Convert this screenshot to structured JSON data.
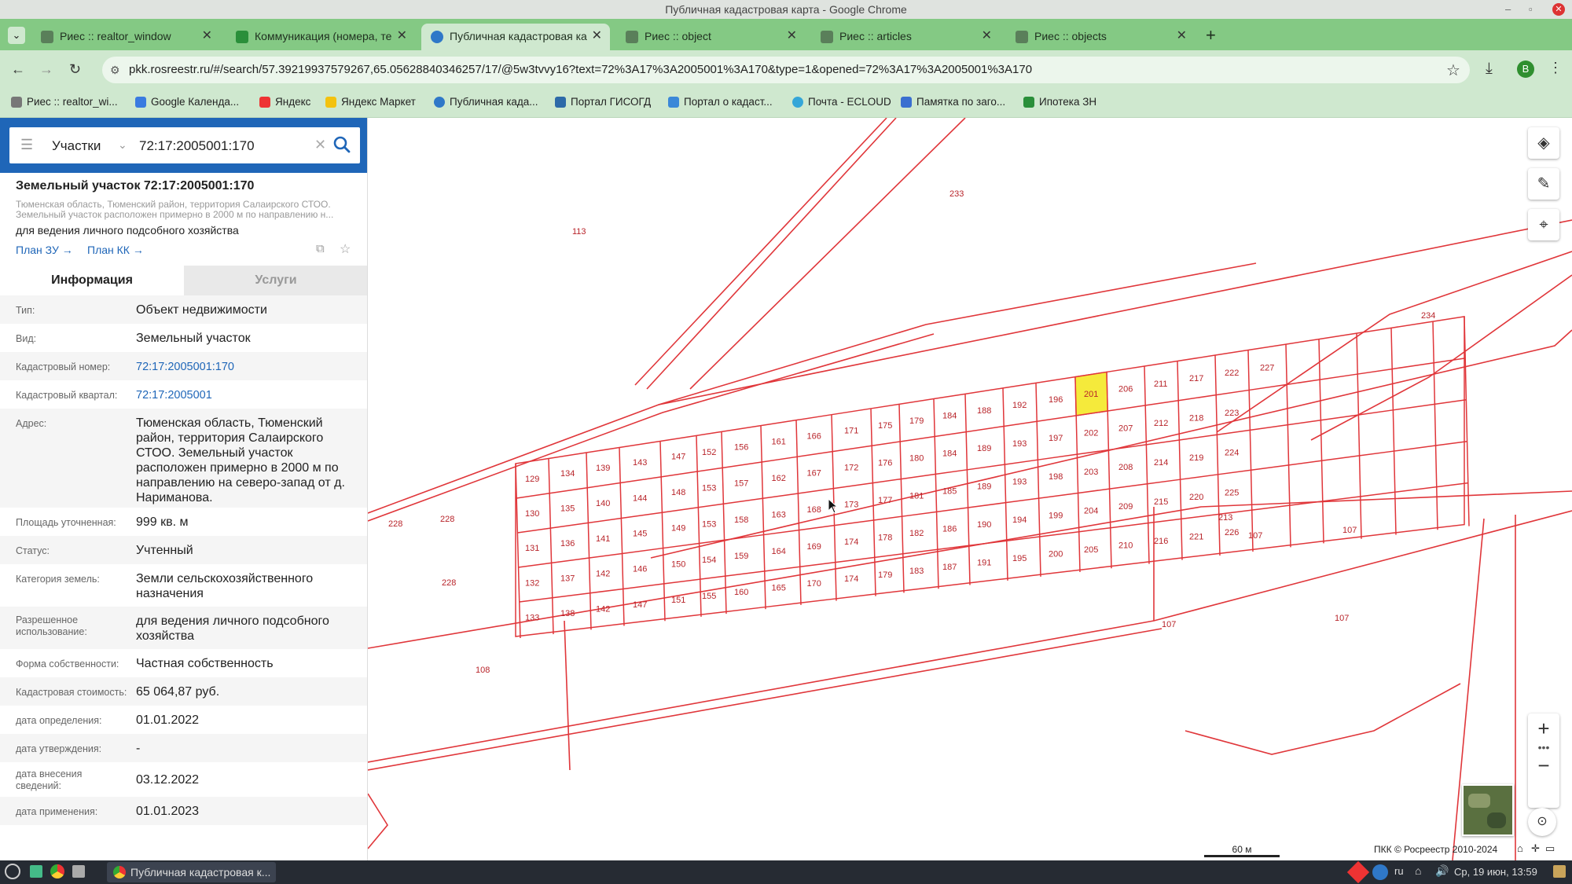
{
  "window": {
    "title": "Публичная кадастровая карта - Google Chrome"
  },
  "tabs": [
    {
      "label": "Риес :: realtor_window"
    },
    {
      "label": "Коммуникация (номера, те"
    },
    {
      "label": "Публичная кадастровая ка",
      "active": true
    },
    {
      "label": "Риес :: object"
    },
    {
      "label": "Риес :: articles"
    },
    {
      "label": "Риес :: objects"
    }
  ],
  "address_bar": {
    "url": "pkk.rosreestr.ru/#/search/57.39219937579267,65.05628840346257/17/@5w3tvvy16?text=72%3A17%3A2005001%3A170&type=1&opened=72%3A17%3A2005001%3A170",
    "profile_initial": "B"
  },
  "bookmarks": [
    {
      "label": "Риес :: realtor_wi..."
    },
    {
      "label": "Google Календа..."
    },
    {
      "label": "Яндекс"
    },
    {
      "label": "Яндекс Маркет"
    },
    {
      "label": "Публичная када..."
    },
    {
      "label": "Портал ГИСОГД"
    },
    {
      "label": "Портал о кадаст..."
    },
    {
      "label": "Почта - ECLOUD"
    },
    {
      "label": "Памятка по заго..."
    },
    {
      "label": "Ипотека ЗН"
    }
  ],
  "search": {
    "type": "Участки",
    "value": "72:17:2005001:170"
  },
  "parcel": {
    "title": "Земельный участок 72:17:2005001:170",
    "address_short_1": "Тюменская область, Тюменский район, территория Салаирского СТОО.",
    "address_short_2": "Земельный участок расположен примерно в 2000 м по направлению н...",
    "usage": "для ведения личного подсобного хозяйства",
    "plan_zu": "План ЗУ →",
    "plan_kk": "План КК →"
  },
  "info_tabs": {
    "info": "Информация",
    "services": "Услуги"
  },
  "info_rows": [
    {
      "label": "Тип:",
      "value": "Объект недвижимости"
    },
    {
      "label": "Вид:",
      "value": "Земельный участок"
    },
    {
      "label": "Кадастровый номер:",
      "value": "72:17:2005001:170"
    },
    {
      "label": "Кадастровый квартал:",
      "value": "72:17:2005001"
    },
    {
      "label": "Адрес:",
      "value": "Тюменская область, Тюменский район, территория Салаирского СТОО. Земельный участок расположен примерно в 2000 м по направлению на северо-запад от д. Нариманова."
    },
    {
      "label": "Площадь уточненная:",
      "value": "999 кв. м"
    },
    {
      "label": "Статус:",
      "value": "Учтенный"
    },
    {
      "label": "Категория земель:",
      "value": "Земли сельскохозяйственного назначения"
    },
    {
      "label": "Разрешенное использование:",
      "value": "для ведения личного подсобного хозяйства"
    },
    {
      "label": "Форма собственности:",
      "value": "Частная собственность"
    },
    {
      "label": "Кадастровая стоимость:",
      "value": "65 064,87 руб."
    },
    {
      "label": "дата определения:",
      "value": "01.01.2022"
    },
    {
      "label": "дата утверждения:",
      "value": "-"
    },
    {
      "label": "дата внесения сведений:",
      "value": "03.12.2022"
    },
    {
      "label": "дата применения:",
      "value": "01.01.2023"
    }
  ],
  "map": {
    "scale": "60 м",
    "copyright": "ПКК © Росреестр 2010-2024",
    "selected_parcel": "170",
    "outer_labels": [
      "233",
      "113",
      "228",
      "228",
      "228",
      "107",
      "107",
      "107",
      "107",
      "108",
      "234",
      "213"
    ],
    "parcel_labels": [
      "129",
      "130",
      "131",
      "132",
      "133",
      "134",
      "135",
      "136",
      "137",
      "138",
      "139",
      "140",
      "141",
      "142",
      "142",
      "143",
      "144",
      "145",
      "146",
      "147",
      "147",
      "148",
      "149",
      "150",
      "151",
      "152",
      "153",
      "153",
      "154",
      "155",
      "156",
      "157",
      "158",
      "159",
      "160",
      "161",
      "162",
      "163",
      "164",
      "165",
      "166",
      "167",
      "168",
      "169",
      "170",
      "171",
      "172",
      "173",
      "174",
      "174",
      "175",
      "176",
      "177",
      "178",
      "179",
      "179",
      "180",
      "181",
      "182",
      "183",
      "184",
      "184",
      "185",
      "186",
      "187",
      "188",
      "189",
      "189",
      "190",
      "191",
      "192",
      "193",
      "193",
      "194",
      "195",
      "196",
      "197",
      "198",
      "199",
      "200",
      "201",
      "202",
      "203",
      "204",
      "205",
      "206",
      "207",
      "208",
      "209",
      "210",
      "211",
      "212",
      "214",
      "215",
      "216",
      "217",
      "218",
      "219",
      "220",
      "221",
      "222",
      "223",
      "224",
      "225",
      "226",
      "227"
    ]
  },
  "taskbar": {
    "app": "Публичная кадастровая к...",
    "lang": "ru",
    "clock": "Ср, 19 июн, 13:59"
  },
  "colors": {
    "tabbar": "#84c984",
    "toolbar": "#cfe8cf",
    "search_panel": "#1f66b8",
    "parcel_line": "#e0363a",
    "parcel_label": "#b8242a",
    "selected_fill": "#f5ea3b"
  }
}
